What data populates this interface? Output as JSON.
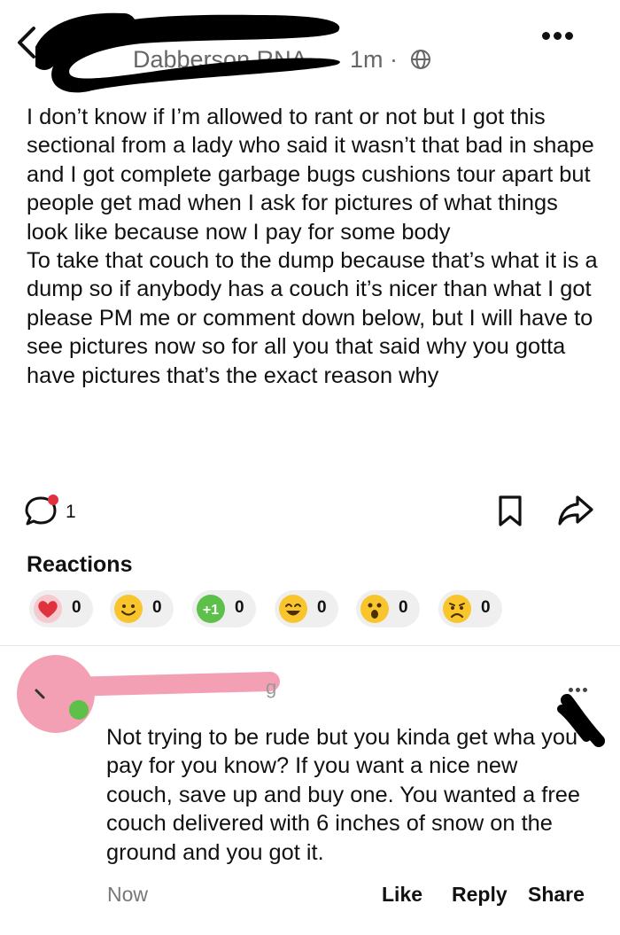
{
  "header": {
    "author_partial": "Dabberson RNA",
    "timestamp": "1m",
    "separator": "·"
  },
  "post": {
    "paragraphs": [
      "I don’t know if I’m allowed to rant or not but I got this sectional from a lady who said it wasn’t that bad in shape and I got complete garbage bugs cushions tour apart but people get mad when I ask for pictures of what things look like because now I pay for some body",
      "To take that couch to the dump because that’s what it is a dump so if anybody has a couch it’s nicer than what I got please PM me or comment down below, but I will have to see pictures now so for all you that said why you gotta have pictures that’s the exact reason why"
    ]
  },
  "actions": {
    "comment_count": "1"
  },
  "reactions": {
    "title": "Reactions",
    "items": [
      {
        "icon": "heart-icon",
        "count": "0"
      },
      {
        "icon": "smile-icon",
        "count": "0"
      },
      {
        "icon": "plus-one-icon",
        "label": "+1",
        "count": "0"
      },
      {
        "icon": "grin-icon",
        "count": "0"
      },
      {
        "icon": "wow-icon",
        "count": "0"
      },
      {
        "icon": "sad-icon",
        "count": "0"
      }
    ]
  },
  "comment": {
    "author_partial": "g",
    "text": "Not trying to be rude but you kinda get wha you pay for you know? If you want a nice new couch, save up and buy one. You wanted a free couch delivered with 6 inches of snow on the ground and you got it.",
    "time": "Now",
    "like_label": "Like",
    "reply_label": "Reply",
    "share_label": "Share"
  },
  "colors": {
    "redaction_black": "#000000",
    "redaction_pink": "#f4a0b4",
    "notification_red": "#e0323c",
    "emoji_yellow": "#f9c52d",
    "plus_one_green": "#5cc04a"
  }
}
